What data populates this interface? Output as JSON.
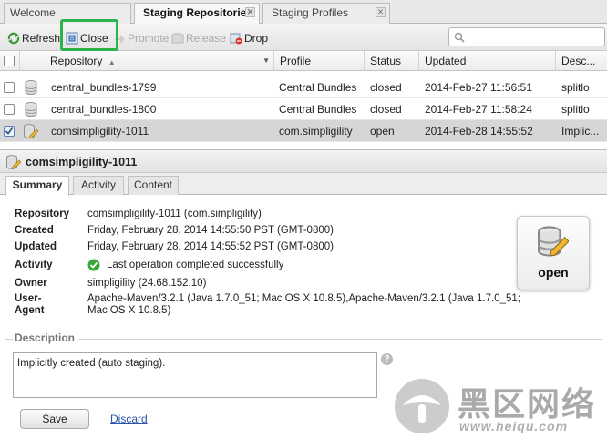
{
  "tabs": [
    {
      "label": "Welcome"
    },
    {
      "label": "Staging Repositorie"
    },
    {
      "label": "Staging Profiles"
    }
  ],
  "toolbar": {
    "refresh": "Refresh",
    "close": "Close",
    "promote": "Promote",
    "release": "Release",
    "drop": "Drop",
    "search_placeholder": ""
  },
  "grid": {
    "columns": [
      "Repository",
      "Profile",
      "Status",
      "Updated",
      "Desc..."
    ],
    "rows": [
      {
        "repository": "central_bundles-1799",
        "profile": "Central Bundles",
        "status": "closed",
        "updated": "2014-Feb-27 11:56:51",
        "desc": "splitlo",
        "checked": false
      },
      {
        "repository": "central_bundles-1800",
        "profile": "Central Bundles",
        "status": "closed",
        "updated": "2014-Feb-27 11:58:24",
        "desc": "splitlo",
        "checked": false
      },
      {
        "repository": "comsimpligility-1011",
        "profile": "com.simpligility",
        "status": "open",
        "updated": "2014-Feb-28 14:55:52",
        "desc": "Implic...",
        "checked": true
      }
    ]
  },
  "detail": {
    "title": "comsimpligility-1011",
    "tabs": [
      "Summary",
      "Activity",
      "Content"
    ],
    "fields": {
      "repository_label": "Repository",
      "repository_value": "comsimpligility-1011 (com.simpligility)",
      "created_label": "Created",
      "created_value": "Friday, February 28, 2014 14:55:50 PST (GMT-0800)",
      "updated_label": "Updated",
      "updated_value": "Friday, February 28, 2014 14:55:52 PST (GMT-0800)",
      "activity_label": "Activity",
      "activity_value": "Last operation completed successfully",
      "owner_label": "Owner",
      "owner_value": "simpligility (24.68.152.10)",
      "useragent_label_1": "User-",
      "useragent_label_2": "Agent",
      "useragent_value_1": "Apache-Maven/3.2.1 (Java 1.7.0_51; Mac OS X 10.8.5),Apache-Maven/3.2.1 (Java 1.7.0_51;",
      "useragent_value_2": "Mac OS X 10.8.5)"
    },
    "status_badge": "open",
    "description_legend": "Description",
    "description_value": "Implicitly created (auto staging).",
    "save": "Save",
    "discard": "Discard"
  },
  "watermark": {
    "cn": "黑区网络",
    "url": "www.heiqu.com"
  },
  "colors": {
    "highlight": "#2db34a",
    "selected_row": "#d6d6d6",
    "success": "#3aa83a",
    "link": "#2a55a8"
  }
}
